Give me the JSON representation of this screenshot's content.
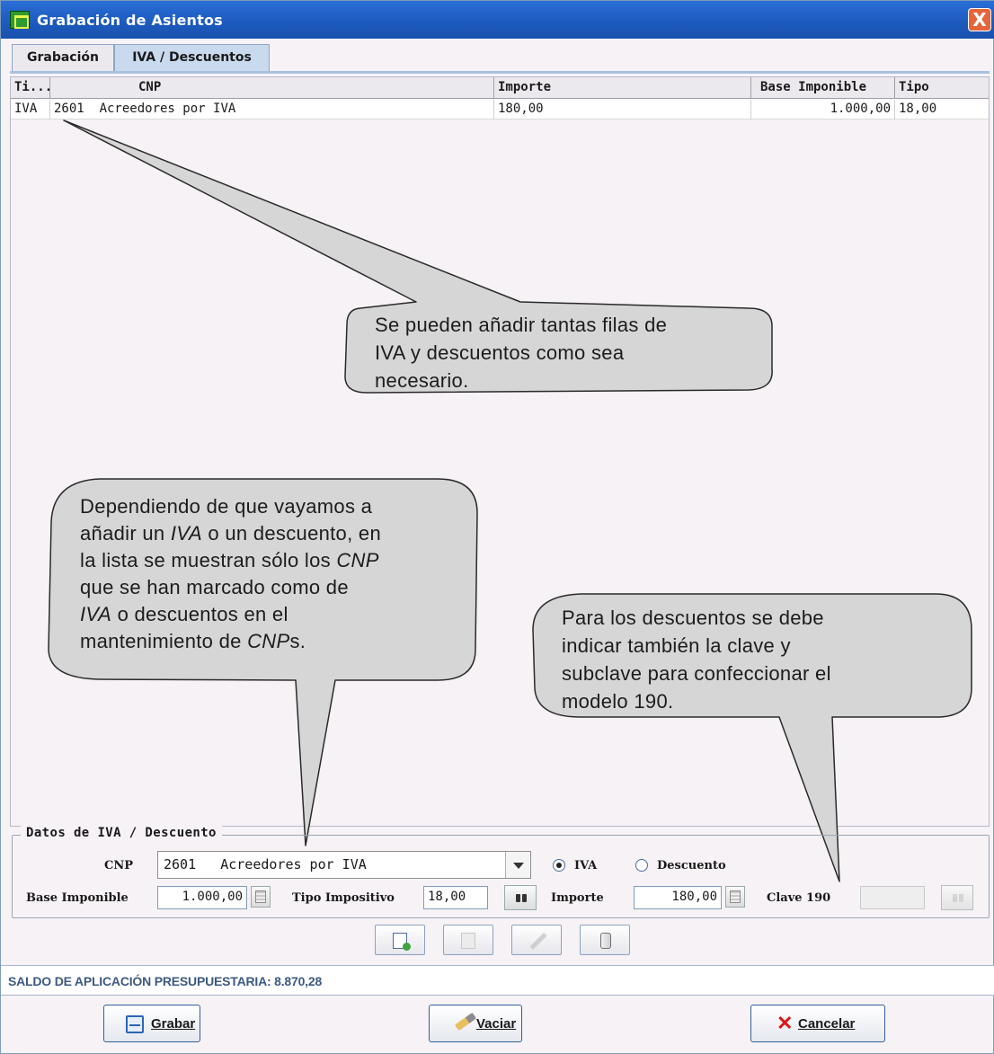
{
  "window": {
    "title": "Grabación de Asientos",
    "close_glyph": "X"
  },
  "tabs": [
    {
      "label": "Grabación",
      "selected": false
    },
    {
      "label": "IVA / Descuentos",
      "selected": true
    }
  ],
  "grid": {
    "columns": [
      "Ti...",
      "CNP",
      "Importe",
      "Base Imponible",
      "Tipo"
    ],
    "rows": [
      {
        "tipo": "IVA",
        "cnp_code": "2601",
        "cnp_name": "Acreedores por IVA",
        "importe": "180,00",
        "base_imponible": "1.000,00",
        "tipo_pct": "18,00"
      }
    ]
  },
  "callouts": {
    "top": {
      "line1": "Se pueden añadir tantas filas de",
      "line2": "IVA y descuentos como sea",
      "line3": "necesario."
    },
    "left": {
      "l1": "Dependiendo de que vayamos a",
      "l2_pre": "añadir un ",
      "l2_em": "IVA",
      "l2_post": " o un descuento, en",
      "l3_pre": "la lista se muestran sólo los ",
      "l3_em": "CNP",
      "l4": "que se han marcado como de",
      "l5_em": "IVA",
      "l5_post": " o descuentos en el",
      "l6_pre": "mantenimiento de ",
      "l6_em": "CNP",
      "l6_post": "s."
    },
    "right": {
      "line1": "Para los descuentos se debe",
      "line2": "indicar también la clave y",
      "line3": "subclave para confeccionar el",
      "line4": "modelo 190."
    }
  },
  "form": {
    "group_title": "Datos de IVA / Descuento",
    "cnp_label": "CNP",
    "cnp_value": "2601   Acreedores por IVA",
    "radio_iva": "IVA",
    "radio_descuento": "Descuento",
    "selected_radio": "IVA",
    "base_label": "Base Imponible",
    "base_value": "1.000,00",
    "tipo_label": "Tipo Impositivo",
    "tipo_value": "18,00",
    "importe_label": "Importe",
    "importe_value": "180,00",
    "clave_label": "Clave 190",
    "clave_value": ""
  },
  "toolbar_icons": [
    "new-row-icon",
    "delete-row-icon",
    "edit-row-icon",
    "clear-icon"
  ],
  "status": {
    "text": "SALDO DE APLICACIÓN PRESUPUESTARIA: 8.870,28"
  },
  "buttons": {
    "save": "Grabar",
    "clear": "Vaciar",
    "cancel": "Cancelar"
  },
  "colors": {
    "title_bar": "#1d5bbf",
    "close": "#e6653b",
    "status_text": "#3d5a80",
    "cancel_icon": "#e01414",
    "callout_fill": "#d6d6d6"
  }
}
